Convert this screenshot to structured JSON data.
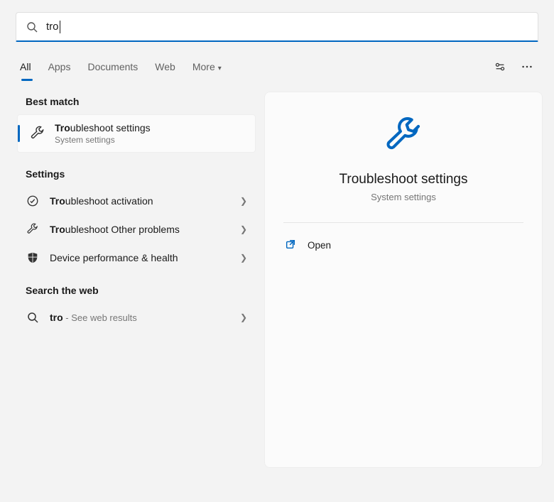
{
  "search": {
    "query": "tro"
  },
  "tabs": {
    "items": [
      "All",
      "Apps",
      "Documents",
      "Web",
      "More"
    ],
    "active_index": 0
  },
  "sections": {
    "best_match_header": "Best match",
    "settings_header": "Settings",
    "web_header": "Search the web"
  },
  "best_match": {
    "boldPrefix": "Tro",
    "titleRest": "ubleshoot settings",
    "subtitle": "System settings",
    "icon": "wrench-icon"
  },
  "settings_results": [
    {
      "boldPrefix": "Tro",
      "labelRest": "ubleshoot activation",
      "icon": "check-circle-icon"
    },
    {
      "boldPrefix": "Tro",
      "labelRest": "ubleshoot Other problems",
      "icon": "wrench-icon"
    },
    {
      "boldPrefix": "",
      "labelRest": "Device performance & health",
      "icon": "shield-icon"
    }
  ],
  "web_results": [
    {
      "boldPrefix": "tro",
      "suffix": " - See web results",
      "icon": "search-icon"
    }
  ],
  "preview": {
    "title": "Troubleshoot settings",
    "subtitle": "System settings",
    "actions": [
      {
        "label": "Open",
        "icon": "open-external-icon"
      }
    ]
  }
}
